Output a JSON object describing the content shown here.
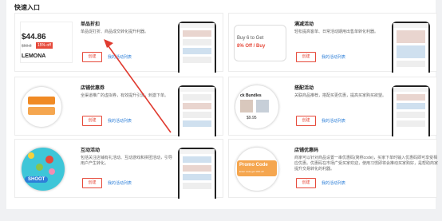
{
  "section_title": "快速入口",
  "cards": [
    {
      "name": "单品折扣",
      "desc": "单品促打折、商品成交转化提升利器。",
      "create": "创建",
      "list": "我的活动列表",
      "thumb_price": "$44.86",
      "thumb_old": "$59.8",
      "thumb_off": "15% off",
      "thumb_word": "LEMONA"
    },
    {
      "name": "满减活动",
      "desc": "轻松提高客单、日常活动期用出售单转化利器。",
      "create": "创建",
      "list": "我的活动列表",
      "thumb_line1": "Buy 6 to Get",
      "thumb_line2": "8% Off / Buy"
    },
    {
      "name": "店铺优惠券",
      "desc": "全渠道推广的虚拟券，有效提升引流，刺激下单。",
      "create": "创建",
      "list": "我的活动列表"
    },
    {
      "name": "搭配活动",
      "desc": "关联商品推荐，搭配买更优惠，提高买家购买欲望。",
      "create": "创建",
      "list": "我的活动列表",
      "thumb_word": "ck Bundles",
      "thumb_price": "$9.95"
    },
    {
      "name": "互动活动",
      "desc": "包括关注店铺有礼活动、互动游戏和拼团活动，引导用户产生转化。",
      "create": "创建",
      "list": "我的活动列表",
      "thumb_word": "SHOOT"
    },
    {
      "name": "店铺优惠码",
      "desc": "商家可以针对商品设置一串优惠码(简称code)，买家下单时输入优惠码即可享受相应优惠。优惠码在市场广受买家欢迎，使用习惯即将会推动买家购好，是帮助商家提升交易转化的利器。",
      "create": "创建",
      "list": "我的活动列表",
      "thumb_line1": "Promo Code",
      "thumb_line2": "Enter code get 10% off"
    }
  ]
}
